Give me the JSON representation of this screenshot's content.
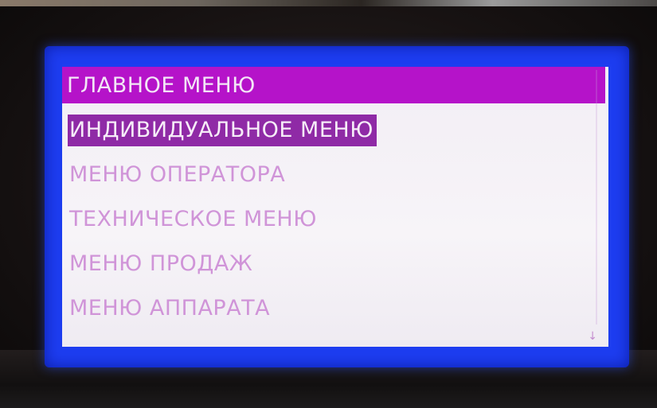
{
  "screen": {
    "title": "ГЛАВНОЕ МЕНЮ",
    "accent_color": "#b513c9",
    "selected_index": 0
  },
  "menu": {
    "items": [
      {
        "label": "ИНДИВИДУАЛЬНОЕ МЕНЮ",
        "selected": true
      },
      {
        "label": "МЕНЮ ОПЕРАТОРА",
        "selected": false
      },
      {
        "label": "ТЕХНИЧЕСКОЕ МЕНЮ",
        "selected": false
      },
      {
        "label": "МЕНЮ ПРОДАЖ",
        "selected": false
      },
      {
        "label": "МЕНЮ АППАРАТА",
        "selected": false
      }
    ]
  },
  "scroll_indicator": {
    "icon": "arrow-down-icon",
    "glyph": "↓"
  }
}
